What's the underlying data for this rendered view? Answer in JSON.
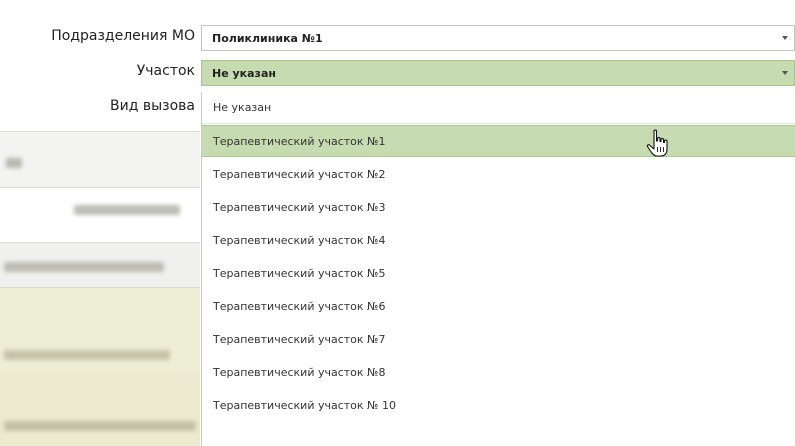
{
  "form": {
    "subdivision": {
      "label": "Подразделения МО",
      "value": "Поликлиника №1"
    },
    "district": {
      "label": "Участок",
      "value": "Не указан"
    },
    "call_type": {
      "label": "Вид вызова"
    }
  },
  "dropdown": {
    "options": [
      "Не указан",
      "Терапевтический участок №1",
      "Терапевтический участок №2",
      "Терапевтический участок №3",
      "Терапевтический участок №4",
      "Терапевтический участок №5",
      "Терапевтический участок №6",
      "Терапевтический участок №7",
      "Терапевтический участок №8",
      "Терапевтический участок № 10"
    ],
    "hovered_index": 1
  },
  "colors": {
    "selected_green": "#c6dcb0",
    "background_yellow": "#eeeed4"
  },
  "icons": {
    "combo_arrow": "chevron-down-icon",
    "cursor": "hand-pointer-icon"
  }
}
